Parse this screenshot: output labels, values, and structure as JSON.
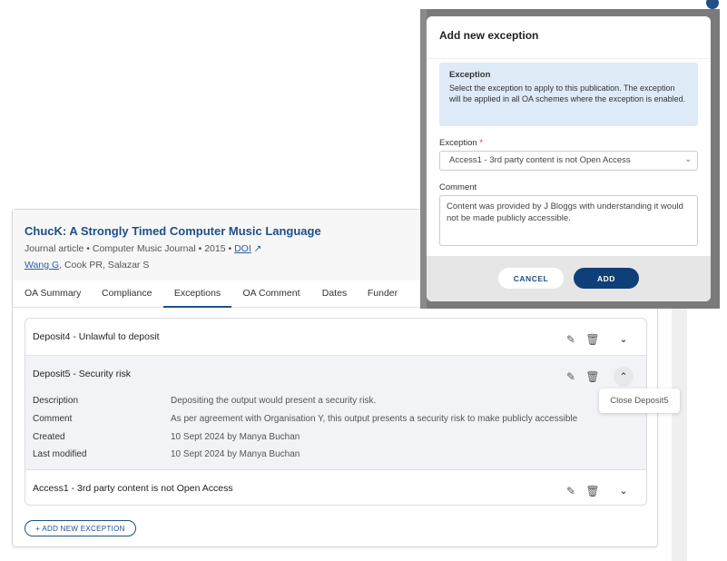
{
  "publication": {
    "title": "ChucK: A Strongly Timed Computer Music Language",
    "type": "Journal article",
    "journal": "Computer Music Journal",
    "year": "2015",
    "doi_label": "DOI",
    "author_link": "Wang G",
    "authors_rest": ", Cook PR, Salazar S"
  },
  "tabs": [
    {
      "label": "OA Summary"
    },
    {
      "label": "Compliance"
    },
    {
      "label": "Exceptions"
    },
    {
      "label": "OA Comment"
    },
    {
      "label": "Dates"
    },
    {
      "label": "Funder"
    }
  ],
  "exceptions": [
    {
      "title": "Deposit4 - Unlawful to deposit"
    },
    {
      "title": "Deposit5 - Security risk",
      "details": [
        {
          "label": "Description",
          "value": "Depositing the output would present a security risk."
        },
        {
          "label": "Comment",
          "value": "As per agreement with Organisation Y, this output presents a security risk to make publicly accessible"
        },
        {
          "label": "Created",
          "value": "10 Sept 2024 by Manya Buchan"
        },
        {
          "label": "Last modified",
          "value": "10 Sept 2024 by Manya Buchan"
        }
      ]
    },
    {
      "title": "Access1 - 3rd party content is not Open Access"
    }
  ],
  "add_exception_label": "+ ADD NEW EXCEPTION",
  "tooltip": "Close Deposit5",
  "modal": {
    "title": "Add new exception",
    "info_title": "Exception",
    "info_text": "Select the exception to apply to this publication. The exception will be applied in all OA schemes where the exception is enabled.",
    "exception_label": "Exception",
    "required_mark": "*",
    "exception_value": "Access1 - 3rd party content is not Open Access",
    "comment_label": "Comment",
    "comment_value": "Content was provided by J Bloggs with understanding it would not be made publicly accessible.",
    "cancel_label": "CANCEL",
    "add_label": "ADD"
  }
}
